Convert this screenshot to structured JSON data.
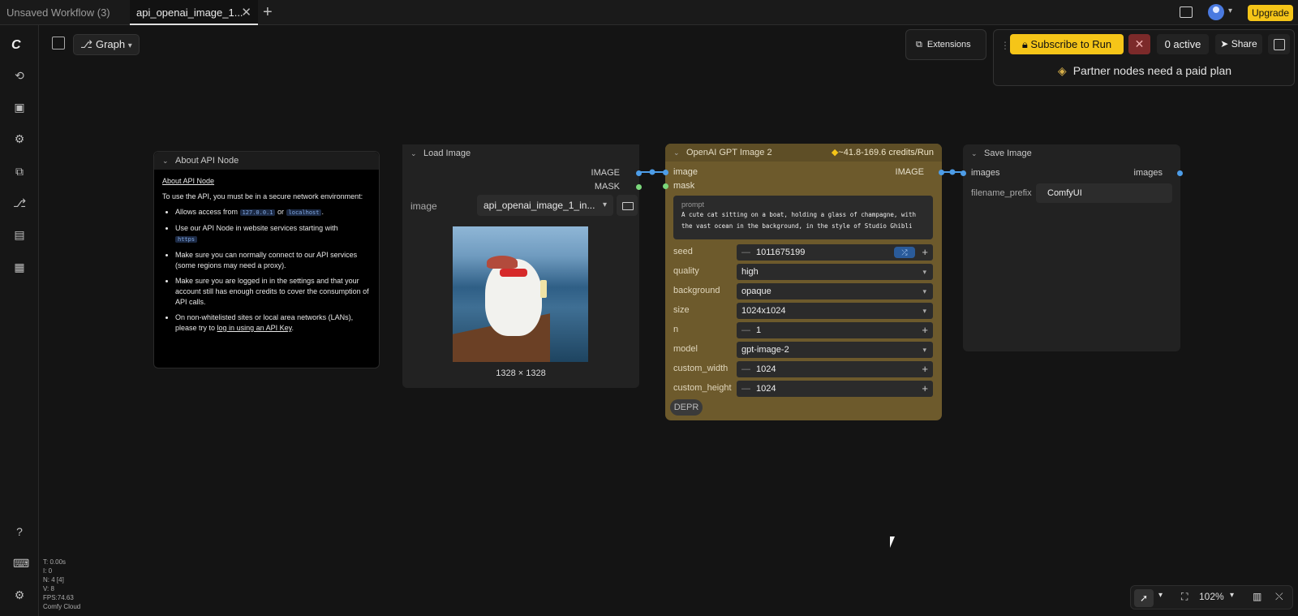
{
  "tabs": [
    {
      "label": "Unsaved Workflow (3)"
    },
    {
      "label": "api_openai_image_1..."
    }
  ],
  "topbar": {
    "upgrade_label": "Upgrade"
  },
  "toolbar": {
    "graph_label": "Graph"
  },
  "run_panel": {
    "extensions_label": "Extensions",
    "subscribe_label": "Subscribe to Run",
    "active_label": "0 active",
    "share_label": "Share",
    "partner_note": "Partner nodes need a paid plan"
  },
  "about_node": {
    "title": "About API Node",
    "heading": "About API Node",
    "intro": "To use the API, you must be in a secure network environment:",
    "bullet1_pre": "Allows access from",
    "bullet1_code1": "127.0.0.1",
    "bullet1_mid": "or",
    "bullet1_code2": "localhost",
    "bullet2_pre": "Use our API Node in website services starting with",
    "bullet2_code": "https",
    "bullet3": "Make sure you can normally connect to our API services (some regions may need a proxy).",
    "bullet4": "Make sure you are logged in in the settings and that your account still has enough credits to cover the consumption of API calls.",
    "bullet5_pre": "On non-whitelisted sites or local area networks (LANs), please try to",
    "bullet5_link": "log in using an API Key"
  },
  "load_node": {
    "title": "Load Image",
    "out_image": "IMAGE",
    "out_mask": "MASK",
    "image_label": "image",
    "image_value": "api_openai_image_1_in...",
    "dims": "1328 × 1328"
  },
  "openai_node": {
    "title": "OpenAI GPT Image 2",
    "credits": "~41.8-169.6 credits/Run",
    "in_image": "image",
    "in_mask": "mask",
    "out_image": "IMAGE",
    "prompt_label": "prompt",
    "prompt_line1": "A cute cat sitting on a boat, holding a glass of champagne, with",
    "prompt_line2": "the vast ocean in the background, in the style of Studio Ghibli",
    "seed_label": "seed",
    "seed_value": "1011675199",
    "quality_label": "quality",
    "quality_value": "high",
    "background_label": "background",
    "background_value": "opaque",
    "size_label": "size",
    "size_value": "1024x1024",
    "n_label": "n",
    "n_value": "1",
    "model_label": "model",
    "model_value": "gpt-image-2",
    "cw_label": "custom_width",
    "cw_value": "1024",
    "ch_label": "custom_height",
    "ch_value": "1024",
    "depr_label": "DEPR"
  },
  "save_node": {
    "title": "Save Image",
    "in_images": "images",
    "out_images": "images",
    "prefix_label": "filename_prefix",
    "prefix_value": "ComfyUI"
  },
  "stats": {
    "t": "T: 0.00s",
    "i": "I: 0",
    "n": "N: 4 [4]",
    "v": "V: 8",
    "fps": "FPS:74.63",
    "env": "Comfy Cloud"
  },
  "zoom": {
    "value": "102%"
  },
  "colors": {
    "accent": "#f5c518",
    "link_blue": "#4d9de8",
    "mask_green": "#7bd77b",
    "api_node": "#6d5a2c"
  }
}
